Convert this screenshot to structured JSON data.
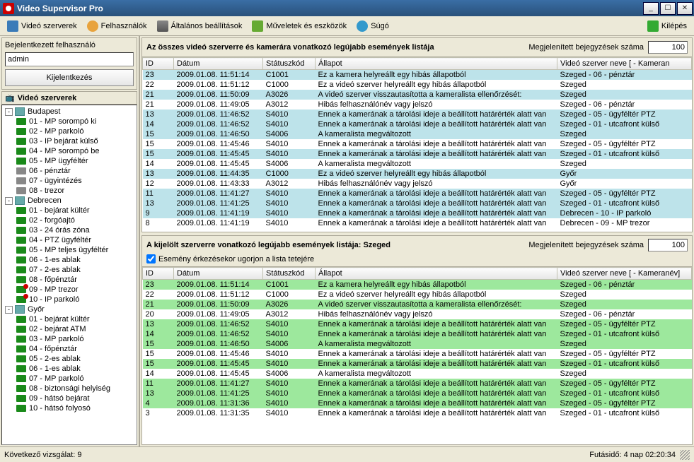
{
  "window": {
    "title": "Video Supervisor Pro"
  },
  "menu": {
    "servers": "Videó szerverek",
    "users": "Felhasználók",
    "settings": "Általános beállítások",
    "tools": "Műveletek és eszközök",
    "help": "Súgó",
    "exit": "Kilépés"
  },
  "sidebar": {
    "user_label": "Bejelentkezett felhasználó",
    "user_value": "admin",
    "logout_btn": "Kijelentkezés",
    "tree_header": "Videó szerverek",
    "tree": [
      {
        "type": "srv",
        "label": "Budapest",
        "exp": "-"
      },
      {
        "type": "cam",
        "label": "01 - MP sorompó ki",
        "st": "on"
      },
      {
        "type": "cam",
        "label": "02 - MP parkoló",
        "st": "on"
      },
      {
        "type": "cam",
        "label": "03 - IP bejárat külső",
        "st": "on"
      },
      {
        "type": "cam",
        "label": "04 - MP sorompó be",
        "st": "on"
      },
      {
        "type": "cam",
        "label": "05 - MP ügyféltér",
        "st": "on"
      },
      {
        "type": "cam",
        "label": "06 - pénztár",
        "st": "off"
      },
      {
        "type": "cam",
        "label": "07 - ügyintézés",
        "st": "off"
      },
      {
        "type": "cam",
        "label": "08 - trezor",
        "st": "off"
      },
      {
        "type": "srv",
        "label": "Debrecen",
        "exp": "-"
      },
      {
        "type": "cam",
        "label": "01 - bejárat kültér",
        "st": "on"
      },
      {
        "type": "cam",
        "label": "02 - forgóajtó",
        "st": "on"
      },
      {
        "type": "cam",
        "label": "03 - 24 órás zóna",
        "st": "on"
      },
      {
        "type": "cam",
        "label": "04 - PTZ ügyféltér",
        "st": "on"
      },
      {
        "type": "cam",
        "label": "05 - MP teljes ügyféltér",
        "st": "on"
      },
      {
        "type": "cam",
        "label": "06 - 1-es ablak",
        "st": "on"
      },
      {
        "type": "cam",
        "label": "07 - 2-es ablak",
        "st": "on"
      },
      {
        "type": "cam",
        "label": "08 - főpénztár",
        "st": "on"
      },
      {
        "type": "cam",
        "label": "09 - MP trezor",
        "st": "rec"
      },
      {
        "type": "cam",
        "label": "10 - IP parkoló",
        "st": "rec"
      },
      {
        "type": "srv",
        "label": "Győr",
        "exp": "-"
      },
      {
        "type": "cam",
        "label": "01 - bejárat kültér",
        "st": "on"
      },
      {
        "type": "cam",
        "label": "02 - bejárat ATM",
        "st": "on"
      },
      {
        "type": "cam",
        "label": "03 - MP parkoló",
        "st": "on"
      },
      {
        "type": "cam",
        "label": "04 - főpénztár",
        "st": "on"
      },
      {
        "type": "cam",
        "label": "05 - 2-es ablak",
        "st": "on"
      },
      {
        "type": "cam",
        "label": "06 - 1-es ablak",
        "st": "on"
      },
      {
        "type": "cam",
        "label": "07 - MP parkoló",
        "st": "on"
      },
      {
        "type": "cam",
        "label": "08 - biztonsági helyiség",
        "st": "on"
      },
      {
        "type": "cam",
        "label": "09 - hátsó bejárat",
        "st": "on"
      },
      {
        "type": "cam",
        "label": "10 - hátsó folyosó",
        "st": "on"
      }
    ]
  },
  "panel_top": {
    "title": "Az összes videó szerverre és kamerára vonatkozó legújabb események listája",
    "count_label": "Megjelenített bejegyzések száma",
    "count_value": "100",
    "cols": [
      "ID",
      "Dátum",
      "Státuszkód",
      "Állapot",
      "Videó szerver neve [ - Kameran"
    ],
    "rows": [
      {
        "hl": 1,
        "c": [
          "23",
          "2009.01.08. 11:51:14",
          "C1001",
          "Ez a kamera helyreállt egy hibás állapotból",
          "Szeged - 06 - pénztár"
        ]
      },
      {
        "hl": 0,
        "c": [
          "22",
          "2009.01.08. 11:51:12",
          "C1000",
          "Ez a videó szerver helyreállt egy hibás állapotból",
          "Szeged"
        ]
      },
      {
        "hl": 1,
        "c": [
          "21",
          "2009.01.08. 11:50:09",
          "A3026",
          "A videó szerver visszautasította a kameralista ellenőrzését:",
          "Szeged"
        ]
      },
      {
        "hl": 0,
        "c": [
          "21",
          "2009.01.08. 11:49:05",
          "A3012",
          "Hibás felhasználónév vagy jelszó",
          "Szeged - 06 - pénztár"
        ]
      },
      {
        "hl": 1,
        "c": [
          "13",
          "2009.01.08. 11:46:52",
          "S4010",
          "Ennek a kamerának a tárolási ideje a beállított határérték alatt van",
          "Szeged - 05 - ügyféltér PTZ"
        ]
      },
      {
        "hl": 1,
        "c": [
          "14",
          "2009.01.08. 11:46:52",
          "S4010",
          "Ennek a kamerának a tárolási ideje a beállított határérték alatt van",
          "Szeged - 01 - utcafront külső"
        ]
      },
      {
        "hl": 1,
        "c": [
          "15",
          "2009.01.08. 11:46:50",
          "S4006",
          "A kameralista megváltozott",
          "Szeged"
        ]
      },
      {
        "hl": 0,
        "c": [
          "15",
          "2009.01.08. 11:45:46",
          "S4010",
          "Ennek a kamerának a tárolási ideje a beállított határérték alatt van",
          "Szeged - 05 - ügyféltér PTZ"
        ]
      },
      {
        "hl": 1,
        "c": [
          "15",
          "2009.01.08. 11:45:45",
          "S4010",
          "Ennek a kamerának a tárolási ideje a beállított határérték alatt van",
          "Szeged - 01 - utcafront külső"
        ]
      },
      {
        "hl": 0,
        "c": [
          "14",
          "2009.01.08. 11:45:45",
          "S4006",
          "A kameralista megváltozott",
          "Szeged"
        ]
      },
      {
        "hl": 1,
        "c": [
          "13",
          "2009.01.08. 11:44:35",
          "C1000",
          "Ez a videó szerver helyreállt egy hibás állapotból",
          "Győr"
        ]
      },
      {
        "hl": 0,
        "c": [
          "12",
          "2009.01.08. 11:43:33",
          "A3012",
          "Hibás felhasználónév vagy jelszó",
          "Győr"
        ]
      },
      {
        "hl": 1,
        "c": [
          "11",
          "2009.01.08. 11:41:27",
          "S4010",
          "Ennek a kamerának a tárolási ideje a beállított határérték alatt van",
          "Szeged - 05 - ügyféltér PTZ"
        ]
      },
      {
        "hl": 1,
        "c": [
          "13",
          "2009.01.08. 11:41:25",
          "S4010",
          "Ennek a kamerának a tárolási ideje a beállított határérték alatt van",
          "Szeged - 01 - utcafront külső"
        ]
      },
      {
        "hl": 1,
        "c": [
          "9",
          "2009.01.08. 11:41:19",
          "S4010",
          "Ennek a kamerának a tárolási ideje a beállított határérték alatt van",
          "Debrecen - 10 - IP parkoló"
        ]
      },
      {
        "hl": 0,
        "c": [
          "8",
          "2009.01.08. 11:41:19",
          "S4010",
          "Ennek a kamerának a tárolási ideje a beállított határérték alatt van",
          "Debrecen - 09 - MP trezor"
        ]
      }
    ]
  },
  "panel_bot": {
    "title": "A kijelölt szerverre vonatkozó legújabb események listája: Szeged",
    "count_label": "Megjelenített bejegyzések száma",
    "count_value": "100",
    "checkbox_label": "Esemény érkezésekor ugorjon a lista tetejére",
    "cols": [
      "ID",
      "Dátum",
      "Státuszkód",
      "Állapot",
      "Videó szerver neve [ - Kameranév]"
    ],
    "rows": [
      {
        "hl": 1,
        "c": [
          "23",
          "2009.01.08. 11:51:14",
          "C1001",
          "Ez a kamera helyreállt egy hibás állapotból",
          "Szeged - 06 - pénztár"
        ]
      },
      {
        "hl": 0,
        "c": [
          "22",
          "2009.01.08. 11:51:12",
          "C1000",
          "Ez a videó szerver helyreállt egy hibás állapotból",
          "Szeged"
        ]
      },
      {
        "hl": 1,
        "c": [
          "21",
          "2009.01.08. 11:50:09",
          "A3026",
          "A videó szerver visszautasította a kameralista ellenőrzését:",
          "Szeged"
        ]
      },
      {
        "hl": 0,
        "c": [
          "20",
          "2009.01.08. 11:49:05",
          "A3012",
          "Hibás felhasználónév vagy jelszó",
          "Szeged - 06 - pénztár"
        ]
      },
      {
        "hl": 1,
        "c": [
          "13",
          "2009.01.08. 11:46:52",
          "S4010",
          "Ennek a kamerának a tárolási ideje a beállított határérték alatt van",
          "Szeged - 05 - ügyféltér PTZ"
        ]
      },
      {
        "hl": 1,
        "c": [
          "14",
          "2009.01.08. 11:46:52",
          "S4010",
          "Ennek a kamerának a tárolási ideje a beállított határérték alatt van",
          "Szeged - 01 - utcafront külső"
        ]
      },
      {
        "hl": 1,
        "c": [
          "15",
          "2009.01.08. 11:46:50",
          "S4006",
          "A kameralista megváltozott",
          "Szeged"
        ]
      },
      {
        "hl": 0,
        "c": [
          "15",
          "2009.01.08. 11:45:46",
          "S4010",
          "Ennek a kamerának a tárolási ideje a beállított határérték alatt van",
          "Szeged - 05 - ügyféltér PTZ"
        ]
      },
      {
        "hl": 1,
        "c": [
          "15",
          "2009.01.08. 11:45:45",
          "S4010",
          "Ennek a kamerának a tárolási ideje a beállított határérték alatt van",
          "Szeged - 01 - utcafront külső"
        ]
      },
      {
        "hl": 0,
        "c": [
          "14",
          "2009.01.08. 11:45:45",
          "S4006",
          "A kameralista megváltozott",
          "Szeged"
        ]
      },
      {
        "hl": 1,
        "c": [
          "11",
          "2009.01.08. 11:41:27",
          "S4010",
          "Ennek a kamerának a tárolási ideje a beállított határérték alatt van",
          "Szeged - 05 - ügyféltér PTZ"
        ]
      },
      {
        "hl": 1,
        "c": [
          "13",
          "2009.01.08. 11:41:25",
          "S4010",
          "Ennek a kamerának a tárolási ideje a beállított határérték alatt van",
          "Szeged - 01 - utcafront külső"
        ]
      },
      {
        "hl": 1,
        "c": [
          "4",
          "2009.01.08. 11:31:36",
          "S4010",
          "Ennek a kamerának a tárolási ideje a beállított határérték alatt van",
          "Szeged - 05 - ügyféltér PTZ"
        ]
      },
      {
        "hl": 0,
        "c": [
          "3",
          "2009.01.08. 11:31:35",
          "S4010",
          "Ennek a kamerának a tárolási ideje a beállított határérték alatt van",
          "Szeged - 01 - utcafront külső"
        ]
      }
    ]
  },
  "status": {
    "left": "Következő vizsgálat: 9",
    "right": "Futásidő: 4 nap 02:20:34"
  }
}
